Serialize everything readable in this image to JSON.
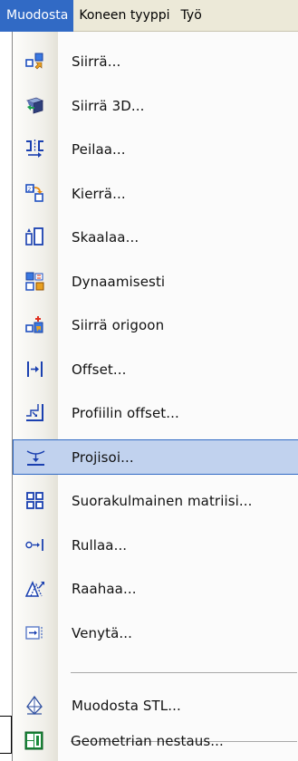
{
  "menubar": {
    "items": [
      {
        "label": "Muodosta"
      },
      {
        "label": "Koneen tyyppi"
      },
      {
        "label": "Työ"
      }
    ]
  },
  "menu": {
    "items": [
      {
        "label": "Siirrä...",
        "icon": "move-icon"
      },
      {
        "label": "Siirrä 3D...",
        "icon": "move-3d-icon"
      },
      {
        "label": "Peilaa...",
        "icon": "mirror-icon"
      },
      {
        "label": "Kierrä...",
        "icon": "rotate-icon"
      },
      {
        "label": "Skaalaa...",
        "icon": "scale-icon"
      },
      {
        "label": "Dynaamisesti",
        "icon": "dynamic-icon"
      },
      {
        "label": "Siirrä origoon",
        "icon": "move-to-origin-icon"
      },
      {
        "label": "Offset...",
        "icon": "offset-icon"
      },
      {
        "label": "Profiilin offset...",
        "icon": "profile-offset-icon"
      },
      {
        "label": "Projisoi...",
        "icon": "project-icon"
      },
      {
        "label": "Suorakulmainen matriisi...",
        "icon": "rectangular-array-icon"
      },
      {
        "label": "Rullaa...",
        "icon": "roll-icon"
      },
      {
        "label": "Raahaa...",
        "icon": "drag-icon"
      },
      {
        "label": "Venytä...",
        "icon": "stretch-icon"
      },
      {
        "label": "Muodosta STL...",
        "icon": "create-stl-icon"
      },
      {
        "label": "Geometrian nestaus...",
        "icon": "nesting-icon"
      }
    ],
    "highlighted_index": 9
  },
  "colors": {
    "menubar_bg": "#ece9d8",
    "active_menu_bg": "#316ac5",
    "highlight_bg": "#c1d2ee",
    "highlight_border": "#316ac5"
  }
}
